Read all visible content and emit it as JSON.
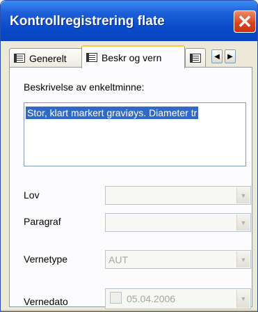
{
  "window": {
    "title": "Kontrollregistrering flate",
    "close_glyph": "✕"
  },
  "tabs": [
    {
      "label": "Generelt",
      "icon": "form-icon",
      "active": false
    },
    {
      "label": "Beskr og vern",
      "icon": "form-icon",
      "active": true
    },
    {
      "label": "",
      "icon": "form-icon",
      "active": false
    }
  ],
  "tab_scroll": {
    "left": "◀",
    "right": "▶"
  },
  "form": {
    "description_label": "Beskrivelse av enkeltminne:",
    "description_value": "Stor, klart markert graviøys. Diameter tr",
    "lov_label": "Lov",
    "lov_value": "",
    "paragraf_label": "Paragraf",
    "paragraf_value": "",
    "vernetype_label": "Vernetype",
    "vernetype_value": "AUT",
    "vernedato_label": "Vernedato",
    "vernedato_value": "05.04.2006",
    "dropdown_glyph": "▼"
  },
  "colors": {
    "titlebar": "#0a49c8",
    "close": "#d9421c",
    "selection": "#3169c6",
    "active_tab_accent": "#ffc83c"
  }
}
